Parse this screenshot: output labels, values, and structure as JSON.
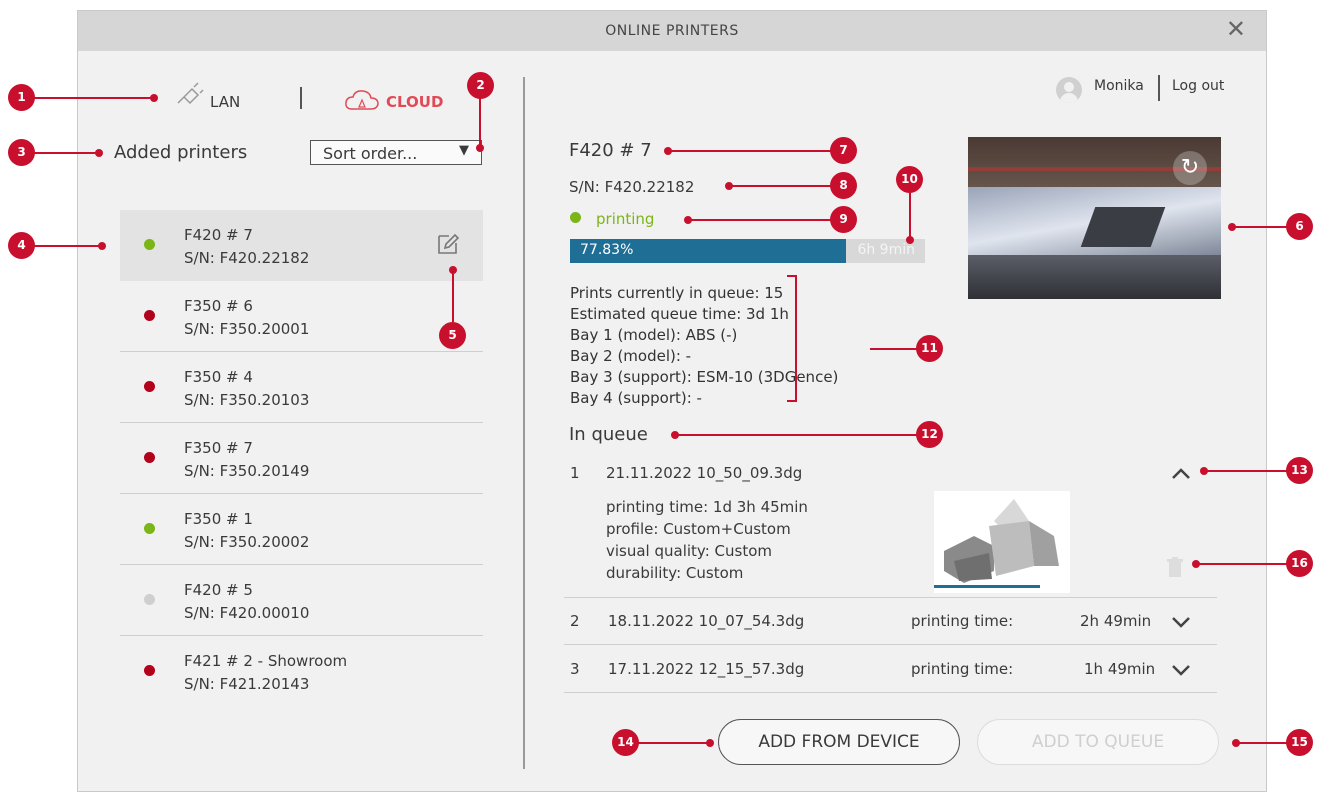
{
  "window": {
    "title": "ONLINE PRINTERS"
  },
  "tabs": {
    "lan": "LAN",
    "cloud": "CLOUD"
  },
  "user": {
    "name": "Monika",
    "logout": "Log out"
  },
  "left": {
    "added_printers": "Added printers",
    "sort_label": "Sort order...",
    "printers": [
      {
        "name": "F420 # 7",
        "serial": "S/N: F420.22182",
        "status": "green"
      },
      {
        "name": "F350 # 6",
        "serial": "S/N: F350.20001",
        "status": "red"
      },
      {
        "name": "F350 # 4",
        "serial": "S/N: F350.20103",
        "status": "red"
      },
      {
        "name": "F350 # 7",
        "serial": "S/N: F350.20149",
        "status": "red"
      },
      {
        "name": "F350 # 1",
        "serial": "S/N: F350.20002",
        "status": "green"
      },
      {
        "name": "F420 # 5",
        "serial": "S/N: F420.00010",
        "status": "grey"
      },
      {
        "name": "F421 # 2 - Showroom",
        "serial": "S/N: F421.20143",
        "status": "red"
      }
    ]
  },
  "detail": {
    "name": "F420 # 7",
    "serial": "S/N: F420.22182",
    "status": "printing",
    "progress_label": "77.83%",
    "progress_fraction": 0.7783,
    "remaining": "6h 9min",
    "info": [
      "Prints currently in queue: 15",
      "Estimated queue time: 3d 1h",
      "Bay 1 (model): ABS (-)",
      "Bay 2 (model): -",
      "Bay 3 (support): ESM-10 (3DGence)",
      "Bay 4 (support): -"
    ],
    "in_queue": "In queue",
    "queue": [
      {
        "num": "1",
        "file": "21.11.2022 10_50_09.3dg",
        "details": [
          "printing time: 1d 3h 45min",
          "profile: Custom+Custom",
          "visual quality: Custom",
          "durability: Custom"
        ]
      },
      {
        "num": "2",
        "file": "18.11.2022 10_07_54.3dg",
        "time_label": "printing time:",
        "time": "2h 49min"
      },
      {
        "num": "3",
        "file": "17.11.2022 12_15_57.3dg",
        "time_label": "printing time:",
        "time": "1h 49min"
      }
    ]
  },
  "buttons": {
    "add_from_device": "ADD FROM DEVICE",
    "add_to_queue": "ADD TO QUEUE"
  },
  "callouts": [
    "1",
    "2",
    "3",
    "4",
    "5",
    "6",
    "7",
    "8",
    "9",
    "10",
    "11",
    "12",
    "13",
    "14",
    "15",
    "16"
  ],
  "colors": {
    "accent": "#c8102e",
    "progress": "#1f6e96",
    "online": "#7cb518",
    "offline": "#b3001b"
  }
}
